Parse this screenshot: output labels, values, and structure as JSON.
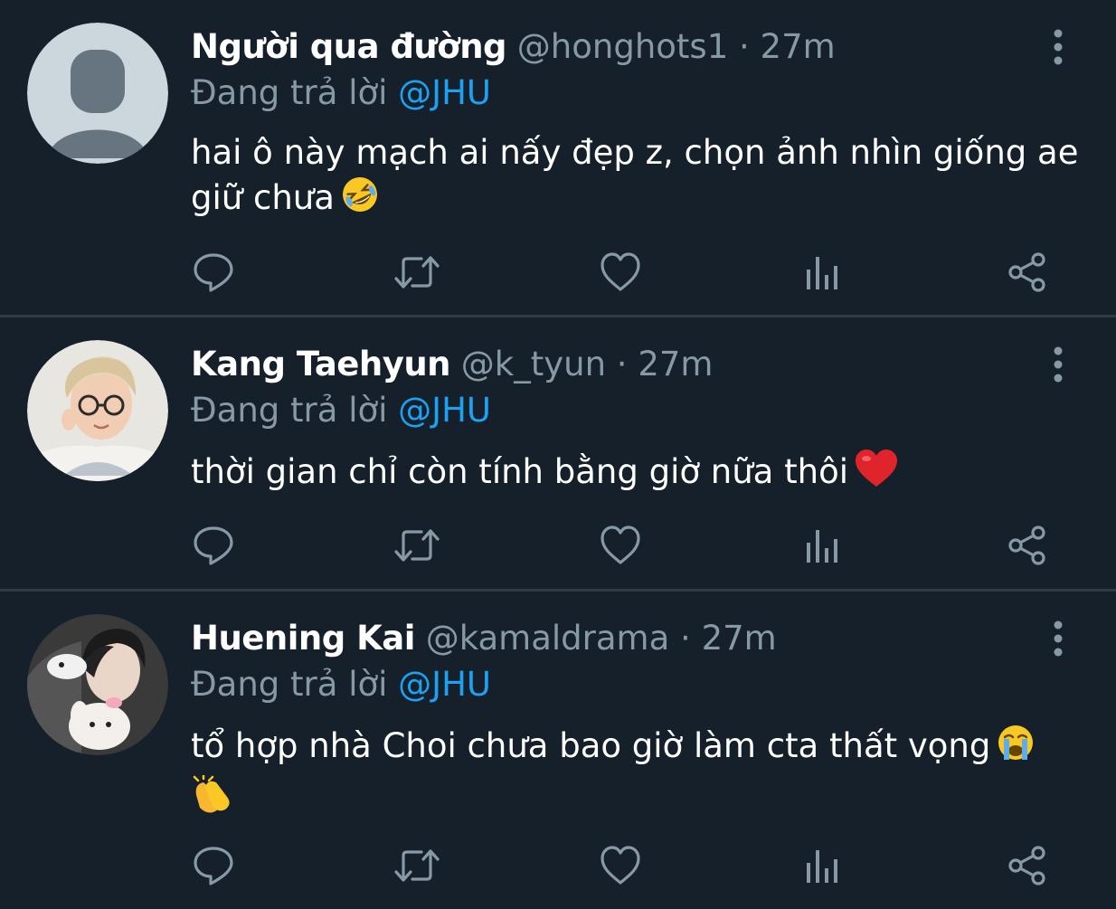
{
  "tweets": [
    {
      "name": "Người qua đường",
      "handle": "@honghots1",
      "sep": "·",
      "time": "27m",
      "reply_prefix": "Đang trả lời",
      "reply_to": "@JHU",
      "text_line1": "hai ô này mạch ai nấy đẹp z, chọn ảnh nhìn giống ae",
      "text_line2": "giữ chưa",
      "emoji": "rolling-on-floor-laughing",
      "avatar": "default-silhouette"
    },
    {
      "name": "Kang Taehyun",
      "handle": "@k_tyun",
      "sep": "·",
      "time": "27m",
      "reply_prefix": "Đang trả lời",
      "reply_to": "@JHU",
      "text_line1": "thời gian chỉ còn tính bằng giờ nữa thôi",
      "emoji": "red-heart",
      "avatar": "photo"
    },
    {
      "name": "Huening Kai",
      "handle": "@kamaldrama",
      "sep": "·",
      "time": "27m",
      "reply_prefix": "Đang trả lời",
      "reply_to": "@JHU",
      "text_line1": "tổ hợp nhà Choi chưa bao giờ làm cta thất vọng",
      "emoji": "loudly-crying-face",
      "emoji2": "clapping-hands",
      "avatar": "photo"
    }
  ],
  "icons": {
    "reply": "reply-icon",
    "retweet": "retweet-icon",
    "like": "heart-icon",
    "stats": "analytics-icon",
    "share": "share-icon",
    "more": "more-vertical-icon"
  },
  "colors": {
    "background": "#15202b",
    "divider": "#2f3a44",
    "secondary_text": "#8899a6",
    "mention": "#1da1f2",
    "icon": "#8899a6"
  }
}
